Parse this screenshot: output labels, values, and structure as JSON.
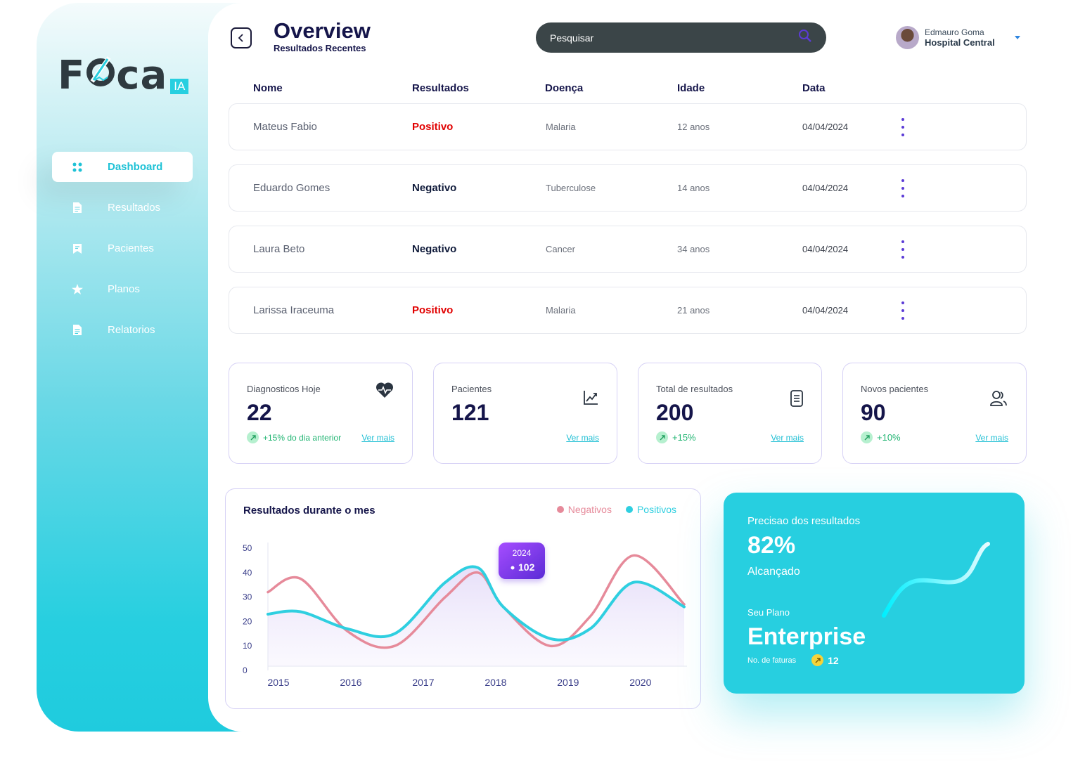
{
  "brand": {
    "name_part1": "F",
    "name_part2": "ca",
    "badge": "IA"
  },
  "sidebar": {
    "items": [
      {
        "label": "Dashboard",
        "icon": "grid-dots-icon",
        "active": true
      },
      {
        "label": "Resultados",
        "icon": "document-icon"
      },
      {
        "label": "Pacientes",
        "icon": "bookmark-list-icon"
      },
      {
        "label": "Planos",
        "icon": "star-icon"
      },
      {
        "label": "Relatorios",
        "icon": "document-icon"
      }
    ]
  },
  "header": {
    "title": "Overview",
    "subtitle": "Resultados Recentes",
    "search_placeholder": "Pesquisar",
    "user_name": "Edmauro Goma",
    "user_org": "Hospital Central"
  },
  "table": {
    "columns": [
      "Nome",
      "Resultados",
      "Doença",
      "Idade",
      "Data"
    ],
    "rows": [
      {
        "name": "Mateus Fabio",
        "result": "Positivo",
        "disease": "Malaria",
        "age": "12 anos",
        "date": "04/04/2024"
      },
      {
        "name": "Eduardo Gomes",
        "result": "Negativo",
        "disease": "Tuberculose",
        "age": "14 anos",
        "date": "04/04/2024"
      },
      {
        "name": "Laura Beto",
        "result": "Negativo",
        "disease": "Cancer",
        "age": "34 anos",
        "date": "04/04/2024"
      },
      {
        "name": "Larissa Iraceuma",
        "result": "Positivo",
        "disease": "Malaria",
        "age": "21 anos",
        "date": "04/04/2024"
      }
    ]
  },
  "stats": [
    {
      "label": "Diagnosticos Hoje",
      "value": "22",
      "trend": "+15% do dia anterior",
      "link": "Ver mais",
      "icon": "heart-pulse-icon"
    },
    {
      "label": "Pacientes",
      "value": "121",
      "trend": "",
      "link": "Ver mais",
      "icon": "trend-chart-icon"
    },
    {
      "label": "Total de resultados",
      "value": "200",
      "trend": "+15%",
      "link": "Ver mais",
      "icon": "clipboard-icon"
    },
    {
      "label": "Novos pacientes",
      "value": "90",
      "trend": "+10%",
      "link": "Ver mais",
      "icon": "users-icon"
    }
  ],
  "colors": {
    "accent": "#27cfe0",
    "positive_red": "#e10000",
    "negatives_series": "#e68a9a",
    "positivos_series": "#2fcfe0",
    "link_purple": "#5b3bd6"
  },
  "chart_data": {
    "type": "line",
    "title": "Resultados durante o mes",
    "ylim": [
      0,
      50
    ],
    "yticks": [
      "50",
      "40",
      "30",
      "20",
      "10",
      "0"
    ],
    "x_labels": [
      "2015",
      "2016",
      "2017",
      "2018",
      "2019",
      "2020"
    ],
    "x": [
      2014.85,
      2015.3,
      2015.95,
      2016.6,
      2017.3,
      2017.75,
      2018.1,
      2018.75,
      2019.3,
      2019.9,
      2020.6
    ],
    "series": [
      {
        "name": "Negativos",
        "color": "#e68a9a",
        "values": [
          32,
          37.5,
          16,
          10,
          30,
          40,
          26,
          10,
          22,
          47,
          27
        ]
      },
      {
        "name": "Positivos",
        "color": "#2fcfe0",
        "values": [
          23,
          24,
          17,
          15,
          36,
          42,
          26,
          13,
          17,
          36,
          26
        ]
      }
    ],
    "tooltip": {
      "year": "2024",
      "value": "102"
    }
  },
  "plan": {
    "label": "Precisao dos resultados",
    "percent": "82%",
    "status": "Alcançado",
    "plan_label": "Seu Plano",
    "plan_name": "Enterprise",
    "invoices_label": "No. de faturas",
    "invoices_count": "12"
  }
}
